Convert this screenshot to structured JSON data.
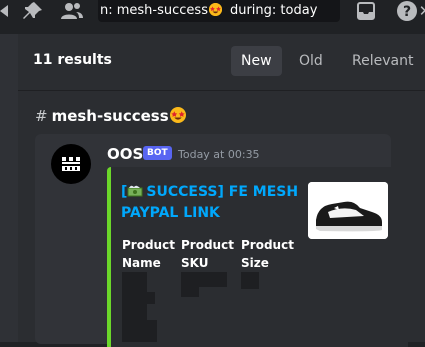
{
  "search": {
    "tokens": [
      "n: mesh-success",
      "during: today"
    ]
  },
  "results": {
    "count_label": "11 results",
    "sort_options": [
      {
        "label": "New",
        "active": true
      },
      {
        "label": "Old",
        "active": false
      },
      {
        "label": "Relevant",
        "active": false
      }
    ]
  },
  "channel": {
    "hash": "#",
    "name": "mesh-success"
  },
  "message": {
    "author": "OOS",
    "badge": "BOT",
    "timestamp": "Today at 00:35",
    "embed": {
      "accent_color": "#6bd72a",
      "title": "[💸 SUCCESS] FE MESH PAYPAL LINK",
      "title_text": "[ SUCCESS] FE MESH PAYPAL LINK",
      "fields": [
        {
          "name_line1": "Product",
          "name_line2": "Name"
        },
        {
          "name_line1": "Product",
          "name_line2": "SKU"
        },
        {
          "name_line1": "Product",
          "name_line2": "Size"
        }
      ]
    }
  },
  "icons": {
    "toolbar": [
      "pin-icon",
      "members-icon",
      "inbox-icon",
      "help-icon"
    ],
    "emoji": "star-struck-emoji"
  },
  "colors": {
    "accent_blue": "#5865f2",
    "link_blue": "#00a8fc",
    "embed_green": "#6bd72a"
  }
}
